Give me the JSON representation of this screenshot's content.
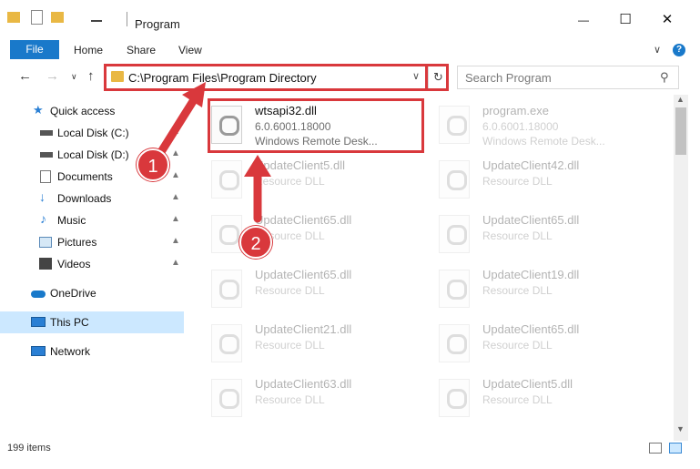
{
  "window": {
    "title": "Program",
    "minimize": "—",
    "maximize": "☐",
    "close": "✕"
  },
  "ribbon": {
    "file": "File",
    "tabs": [
      "Home",
      "Share",
      "View"
    ],
    "help": "?"
  },
  "address": {
    "path": "C:\\Program Files\\Program Directory",
    "refresh": "↻",
    "dropdown": "∨"
  },
  "search": {
    "placeholder": "Search Program",
    "icon": "search-icon"
  },
  "sidebar": {
    "items": [
      {
        "label": "Quick access",
        "icon": "star-icon",
        "pinned": false
      },
      {
        "label": "Local Disk (C:)",
        "icon": "drive-icon",
        "pinned": true
      },
      {
        "label": "Local Disk (D:)",
        "icon": "drive-icon",
        "pinned": true
      },
      {
        "label": "Documents",
        "icon": "documents-icon",
        "pinned": true
      },
      {
        "label": "Downloads",
        "icon": "download-icon",
        "pinned": true
      },
      {
        "label": "Music",
        "icon": "music-icon",
        "pinned": true
      },
      {
        "label": "Pictures",
        "icon": "pictures-icon",
        "pinned": true
      },
      {
        "label": "Videos",
        "icon": "videos-icon",
        "pinned": true
      },
      {
        "label": "OneDrive",
        "icon": "cloud-icon",
        "pinned": false
      },
      {
        "label": "This PC",
        "icon": "computer-icon",
        "pinned": false,
        "selected": true
      },
      {
        "label": "Network",
        "icon": "network-icon",
        "pinned": false
      }
    ]
  },
  "files": [
    {
      "name": "wtsapi32.dll",
      "line2": "6.0.6001.18000",
      "line3": "Windows Remote Desk...",
      "highlighted": true
    },
    {
      "name": "program.exe",
      "line2": "6.0.6001.18000",
      "line3": "Windows Remote Desk..."
    },
    {
      "name": "UpdateClient5.dll",
      "line2": "Resource DLL"
    },
    {
      "name": "UpdateClient42.dll",
      "line2": "Resource DLL"
    },
    {
      "name": "UpdateClient65.dll",
      "line2": "Resource DLL"
    },
    {
      "name": "UpdateClient65.dll",
      "line2": "Resource DLL"
    },
    {
      "name": "UpdateClient65.dll",
      "line2": "Resource DLL"
    },
    {
      "name": "UpdateClient19.dll",
      "line2": "Resource DLL"
    },
    {
      "name": "UpdateClient21.dll",
      "line2": "Resource DLL"
    },
    {
      "name": "UpdateClient65.dll",
      "line2": "Resource DLL"
    },
    {
      "name": "UpdateClient63.dll",
      "line2": "Resource DLL"
    },
    {
      "name": "UpdateClient5.dll",
      "line2": "Resource DLL"
    }
  ],
  "status": {
    "count": "199 items"
  },
  "annotations": {
    "step1": "1",
    "step2": "2",
    "color": "#d9383c"
  }
}
